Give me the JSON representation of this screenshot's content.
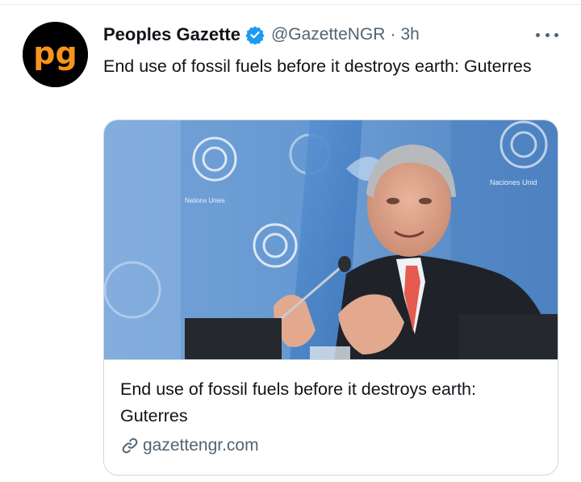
{
  "tweet": {
    "author": {
      "display_name": "Peoples Gazette",
      "handle": "@GazetteNGR",
      "separator": "·",
      "time": "3h",
      "avatar_text": "pg"
    },
    "text": "End use of fossil fuels before it destroys earth: Guterres",
    "card": {
      "title": "End use of fossil fuels before it destroys earth: Guterres",
      "domain": "gazettengr.com",
      "image_banner_left": "Nations Unies",
      "image_banner_right": "Naciones Unid"
    }
  },
  "colors": {
    "verified_blue": "#1d9bf0",
    "avatar_orange": "#f7941d",
    "secondary_text": "#536471",
    "un_blue": "#6fa4db"
  },
  "icons": [
    "verified-badge-icon",
    "more-options-icon",
    "link-icon"
  ]
}
